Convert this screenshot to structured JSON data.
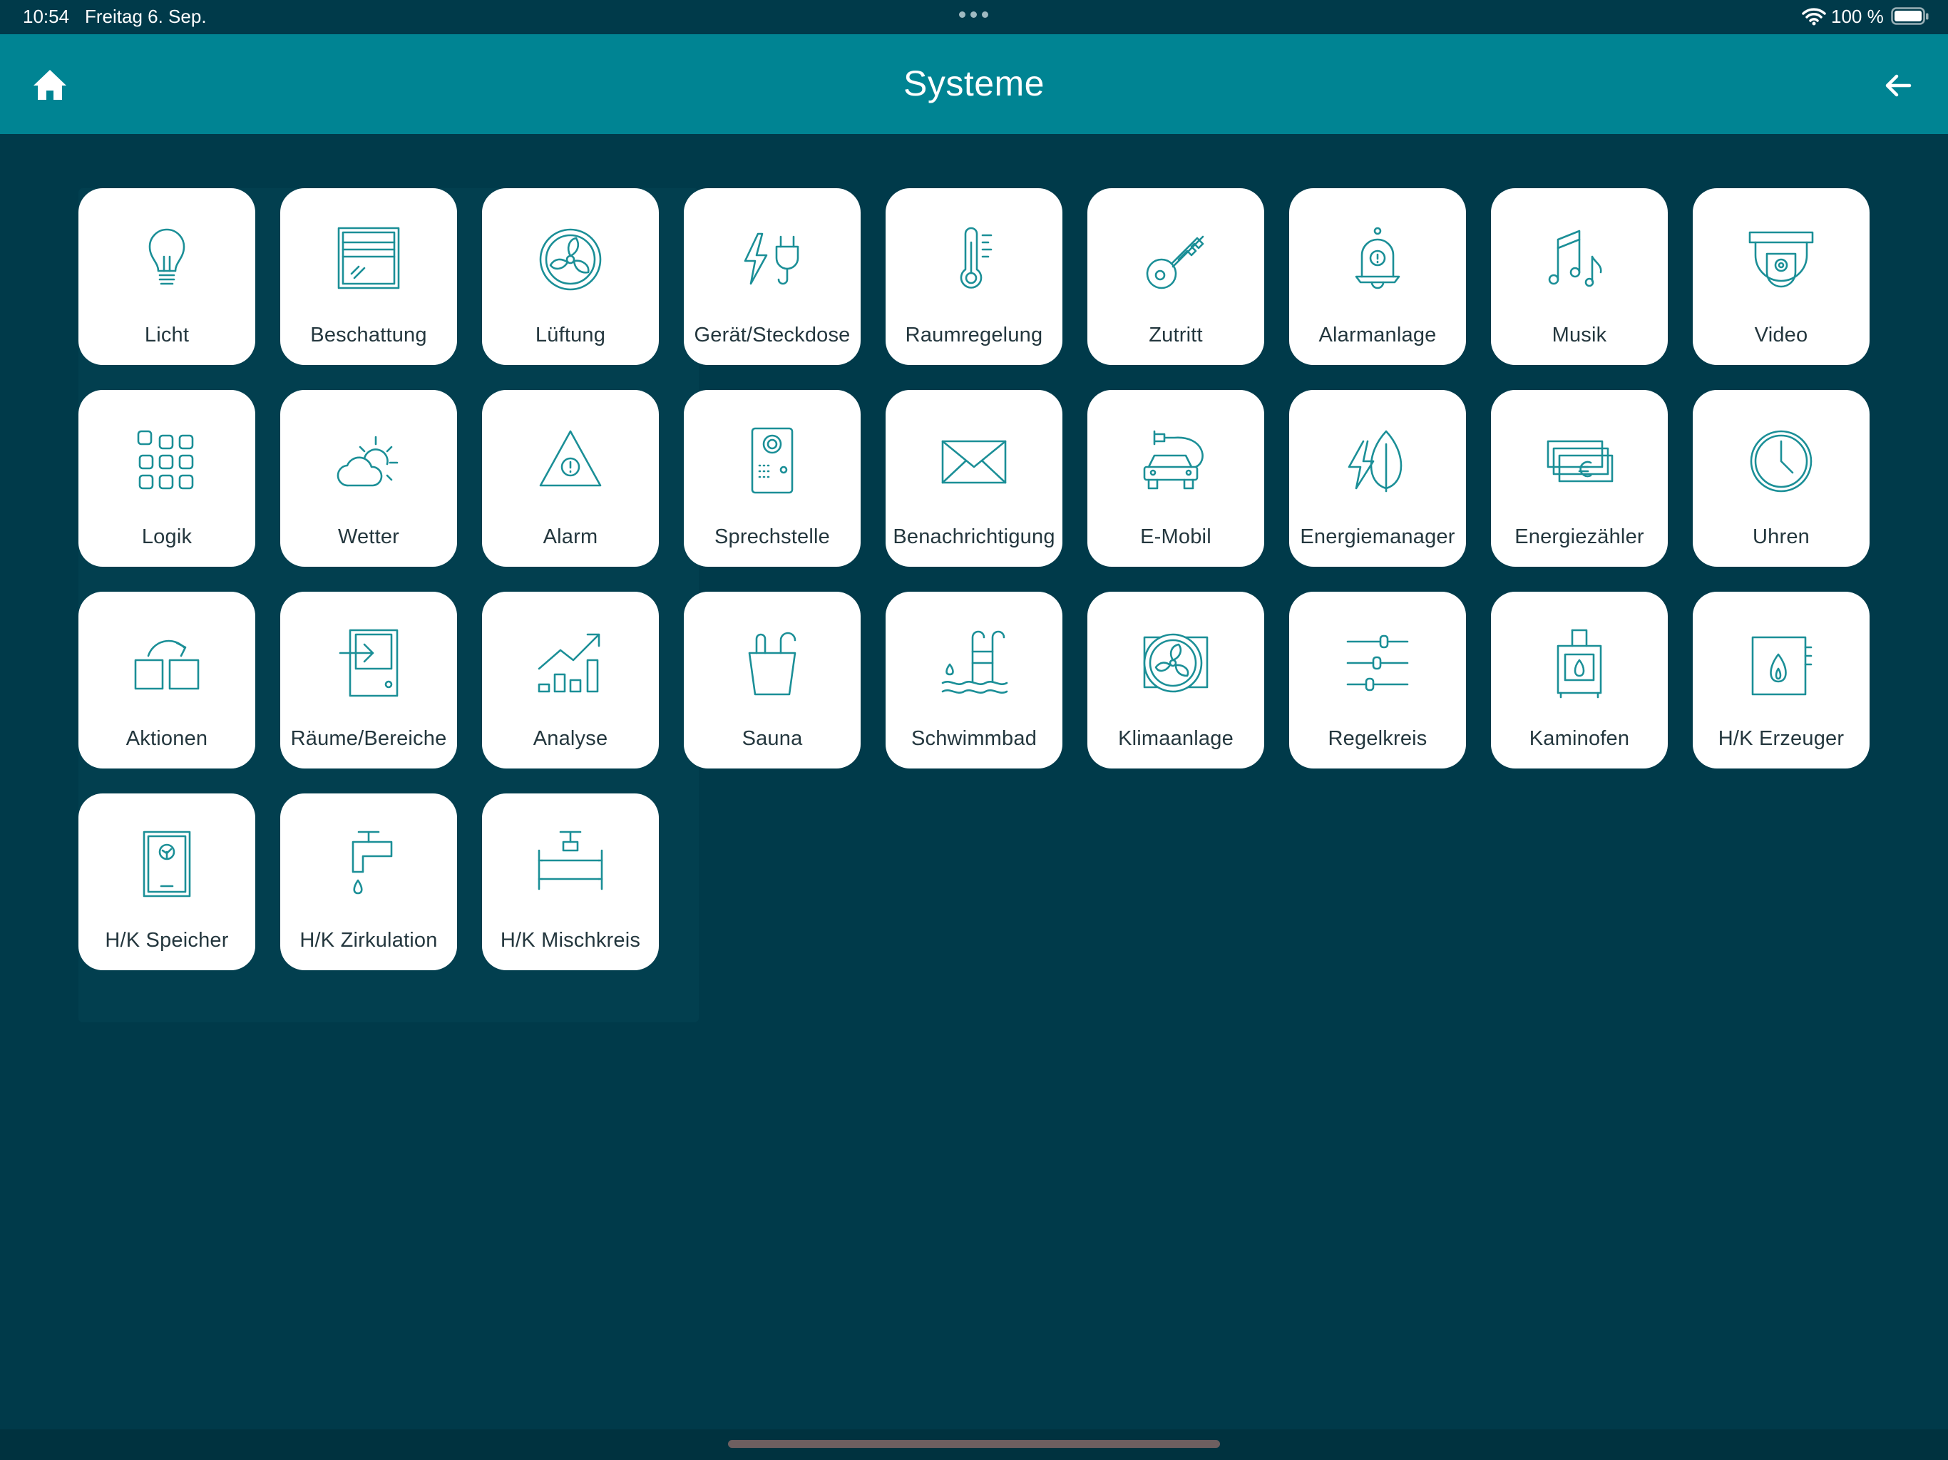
{
  "status_bar": {
    "time": "10:54",
    "date": "Freitag 6. Sep.",
    "battery": "100 %"
  },
  "header": {
    "title": "Systeme"
  },
  "tiles": [
    {
      "label": "Licht",
      "icon": "lightbulb-icon"
    },
    {
      "label": "Beschattung",
      "icon": "blinds-icon"
    },
    {
      "label": "Lüftung",
      "icon": "fan-icon"
    },
    {
      "label": "Gerät/Steckdose",
      "icon": "plug-icon"
    },
    {
      "label": "Raumregelung",
      "icon": "thermometer-icon"
    },
    {
      "label": "Zutritt",
      "icon": "key-icon"
    },
    {
      "label": "Alarmanlage",
      "icon": "alarm-bell-icon"
    },
    {
      "label": "Musik",
      "icon": "music-icon"
    },
    {
      "label": "Video",
      "icon": "camera-icon"
    },
    {
      "label": "Logik",
      "icon": "grid-icon"
    },
    {
      "label": "Wetter",
      "icon": "weather-icon"
    },
    {
      "label": "Alarm",
      "icon": "warning-icon"
    },
    {
      "label": "Sprechstelle",
      "icon": "intercom-icon"
    },
    {
      "label": "Benachrichtigung",
      "icon": "envelope-icon"
    },
    {
      "label": "E-Mobil",
      "icon": "electric-car-icon"
    },
    {
      "label": "Energiemanager",
      "icon": "energy-leaf-icon"
    },
    {
      "label": "Energiezähler",
      "icon": "money-icon"
    },
    {
      "label": "Uhren",
      "icon": "clock-icon"
    },
    {
      "label": "Aktionen",
      "icon": "actions-icon"
    },
    {
      "label": "Räume/Bereiche",
      "icon": "room-door-icon"
    },
    {
      "label": "Analyse",
      "icon": "chart-icon"
    },
    {
      "label": "Sauna",
      "icon": "sauna-bucket-icon"
    },
    {
      "label": "Schwimmbad",
      "icon": "pool-icon"
    },
    {
      "label": "Klimaanlage",
      "icon": "ac-fan-icon"
    },
    {
      "label": "Regelkreis",
      "icon": "sliders-icon"
    },
    {
      "label": "Kaminofen",
      "icon": "stove-icon"
    },
    {
      "label": "H/K Erzeuger",
      "icon": "fireplace-icon"
    },
    {
      "label": "H/K Speicher",
      "icon": "boiler-icon"
    },
    {
      "label": "H/K Zirkulation",
      "icon": "faucet-icon"
    },
    {
      "label": "H/K Mischkreis",
      "icon": "pipe-icon"
    }
  ],
  "colors": {
    "background": "#003a4a",
    "header": "#008493",
    "tile": "#ffffff",
    "icon": "#1b8f97",
    "label": "#24373e"
  }
}
